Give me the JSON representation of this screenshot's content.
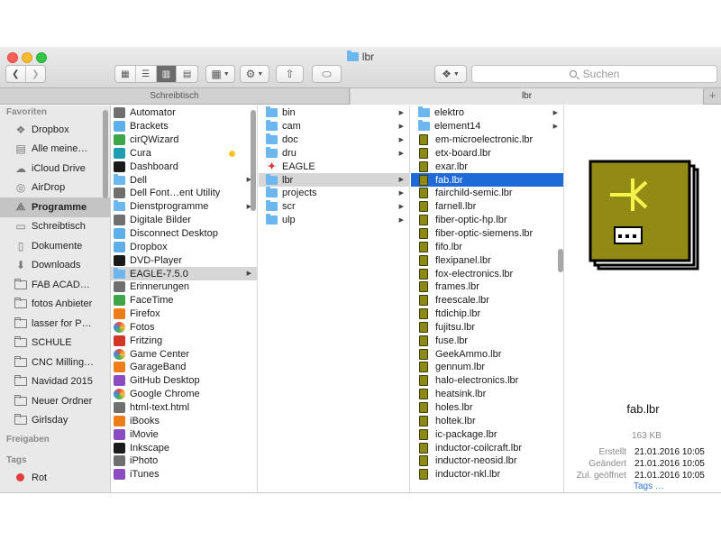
{
  "window": {
    "title": "lbr"
  },
  "search": {
    "placeholder": "Suchen"
  },
  "tabs": [
    {
      "label": "Schreibtisch"
    },
    {
      "label": "lbr"
    }
  ],
  "tab_add": "+",
  "sidebar": {
    "favorites_title": "Favoriten",
    "favorites": [
      {
        "label": "Dropbox",
        "icon": "dropbox-icon"
      },
      {
        "label": "Alle meine…",
        "icon": "all-files-icon"
      },
      {
        "label": "iCloud Drive",
        "icon": "cloud-icon"
      },
      {
        "label": "AirDrop",
        "icon": "airdrop-icon"
      },
      {
        "label": "Programme",
        "icon": "applications-icon",
        "selected": true
      },
      {
        "label": "Schreibtisch",
        "icon": "desktop-icon"
      },
      {
        "label": "Dokumente",
        "icon": "documents-icon"
      },
      {
        "label": "Downloads",
        "icon": "downloads-icon"
      },
      {
        "label": "FAB ACAD…",
        "icon": "folder-icon"
      },
      {
        "label": "fotos Anbieter",
        "icon": "folder-icon"
      },
      {
        "label": "lasser for P…",
        "icon": "folder-icon"
      },
      {
        "label": "SCHULE",
        "icon": "folder-icon"
      },
      {
        "label": "CNC Milling…",
        "icon": "folder-icon"
      },
      {
        "label": "Navidad 2015",
        "icon": "folder-icon"
      },
      {
        "label": "Neuer Ordner",
        "icon": "folder-icon"
      },
      {
        "label": "Girlsday",
        "icon": "folder-icon"
      }
    ],
    "shared_title": "Freigaben",
    "tags_title": "Tags",
    "tags": [
      {
        "label": "Rot",
        "color": "#e43c3c"
      }
    ]
  },
  "column1": [
    {
      "name": "Automator",
      "icon": "gray"
    },
    {
      "name": "Brackets",
      "icon": "blue"
    },
    {
      "name": "cirQWizard",
      "icon": "green"
    },
    {
      "name": "Cura",
      "icon": "teal",
      "dot": true
    },
    {
      "name": "Dashboard",
      "icon": "black"
    },
    {
      "name": "Dell",
      "icon": "fold",
      "arrow": true
    },
    {
      "name": "Dell Font…ent Utility",
      "icon": "gray"
    },
    {
      "name": "Dienstprogramme",
      "icon": "fold",
      "arrow": true
    },
    {
      "name": "Digitale Bilder",
      "icon": "gray"
    },
    {
      "name": "Disconnect Desktop",
      "icon": "blue"
    },
    {
      "name": "Dropbox",
      "icon": "blue"
    },
    {
      "name": "DVD-Player",
      "icon": "black"
    },
    {
      "name": "EAGLE-7.5.0",
      "icon": "fold",
      "arrow": true,
      "highlight": true
    },
    {
      "name": "Erinnerungen",
      "icon": "gray"
    },
    {
      "name": "FaceTime",
      "icon": "green"
    },
    {
      "name": "Firefox",
      "icon": "orange"
    },
    {
      "name": "Fotos",
      "icon": "multi"
    },
    {
      "name": "Fritzing",
      "icon": "red"
    },
    {
      "name": "Game Center",
      "icon": "multi"
    },
    {
      "name": "GarageBand",
      "icon": "orange"
    },
    {
      "name": "GitHub Desktop",
      "icon": "purple"
    },
    {
      "name": "Google Chrome",
      "icon": "multi"
    },
    {
      "name": "html-text.html",
      "icon": "gray"
    },
    {
      "name": "iBooks",
      "icon": "orange"
    },
    {
      "name": "iMovie",
      "icon": "purple"
    },
    {
      "name": "Inkscape",
      "icon": "black"
    },
    {
      "name": "iPhoto",
      "icon": "gray"
    },
    {
      "name": "iTunes",
      "icon": "purple"
    }
  ],
  "column2": [
    {
      "name": "bin",
      "icon": "fold",
      "arrow": true
    },
    {
      "name": "cam",
      "icon": "fold",
      "arrow": true
    },
    {
      "name": "doc",
      "icon": "fold",
      "arrow": true
    },
    {
      "name": "dru",
      "icon": "fold",
      "arrow": true
    },
    {
      "name": "EAGLE",
      "icon": "eagle"
    },
    {
      "name": "lbr",
      "icon": "fold",
      "arrow": true,
      "highlight": true
    },
    {
      "name": "projects",
      "icon": "fold",
      "arrow": true
    },
    {
      "name": "scr",
      "icon": "fold",
      "arrow": true
    },
    {
      "name": "ulp",
      "icon": "fold",
      "arrow": true
    }
  ],
  "column3": [
    {
      "name": "elektro",
      "icon": "fold",
      "arrow": true
    },
    {
      "name": "element14",
      "icon": "fold",
      "arrow": true
    },
    {
      "name": "em-microelectronic.lbr",
      "icon": "lbr"
    },
    {
      "name": "etx-board.lbr",
      "icon": "lbr"
    },
    {
      "name": "exar.lbr",
      "icon": "lbr"
    },
    {
      "name": "fab.lbr",
      "icon": "lbr",
      "selected": true
    },
    {
      "name": "fairchild-semic.lbr",
      "icon": "lbr"
    },
    {
      "name": "farnell.lbr",
      "icon": "lbr"
    },
    {
      "name": "fiber-optic-hp.lbr",
      "icon": "lbr"
    },
    {
      "name": "fiber-optic-siemens.lbr",
      "icon": "lbr"
    },
    {
      "name": "fifo.lbr",
      "icon": "lbr"
    },
    {
      "name": "flexipanel.lbr",
      "icon": "lbr"
    },
    {
      "name": "fox-electronics.lbr",
      "icon": "lbr"
    },
    {
      "name": "frames.lbr",
      "icon": "lbr"
    },
    {
      "name": "freescale.lbr",
      "icon": "lbr"
    },
    {
      "name": "ftdichip.lbr",
      "icon": "lbr"
    },
    {
      "name": "fujitsu.lbr",
      "icon": "lbr"
    },
    {
      "name": "fuse.lbr",
      "icon": "lbr"
    },
    {
      "name": "GeekAmmo.lbr",
      "icon": "lbr"
    },
    {
      "name": "gennum.lbr",
      "icon": "lbr"
    },
    {
      "name": "halo-electronics.lbr",
      "icon": "lbr"
    },
    {
      "name": "heatsink.lbr",
      "icon": "lbr"
    },
    {
      "name": "holes.lbr",
      "icon": "lbr"
    },
    {
      "name": "holtek.lbr",
      "icon": "lbr"
    },
    {
      "name": "ic-package.lbr",
      "icon": "lbr"
    },
    {
      "name": "inductor-coilcraft.lbr",
      "icon": "lbr"
    },
    {
      "name": "inductor-neosid.lbr",
      "icon": "lbr"
    },
    {
      "name": "inductor-nkl.lbr",
      "icon": "lbr"
    }
  ],
  "preview": {
    "name": "fab.lbr",
    "size": "163 KB",
    "meta": [
      {
        "key": "Erstellt",
        "value": "21.01.2016 10:05"
      },
      {
        "key": "Geändert",
        "value": "21.01.2016 10:05"
      },
      {
        "key": "Zul. geöffnet",
        "value": "21.01.2016 10:05"
      }
    ],
    "tags_link": "Tags …"
  }
}
